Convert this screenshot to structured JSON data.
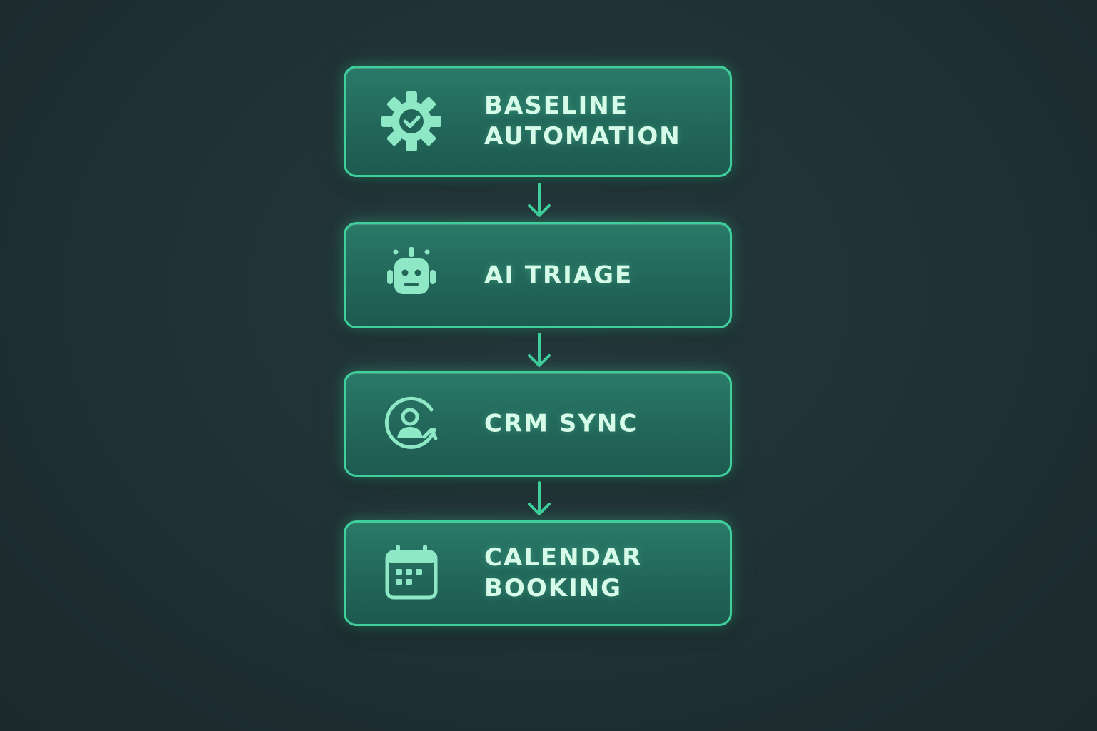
{
  "diagram": {
    "steps": [
      {
        "icon": "gear-check-icon",
        "lines": [
          "BASELINE",
          "AUTOMATION"
        ]
      },
      {
        "icon": "robot-icon",
        "lines": [
          "AI TRIAGE"
        ]
      },
      {
        "icon": "user-sync-icon",
        "lines": [
          "CRM SYNC"
        ]
      },
      {
        "icon": "calendar-icon",
        "lines": [
          "CALENDAR",
          "BOOKING"
        ]
      }
    ]
  },
  "colors": {
    "background": "#203034",
    "box_fill": "#22665a",
    "box_border": "#3fcf9c",
    "text": "#d6fbe9",
    "icon": "#8ee8c6",
    "arrow": "#3fcf9c"
  }
}
